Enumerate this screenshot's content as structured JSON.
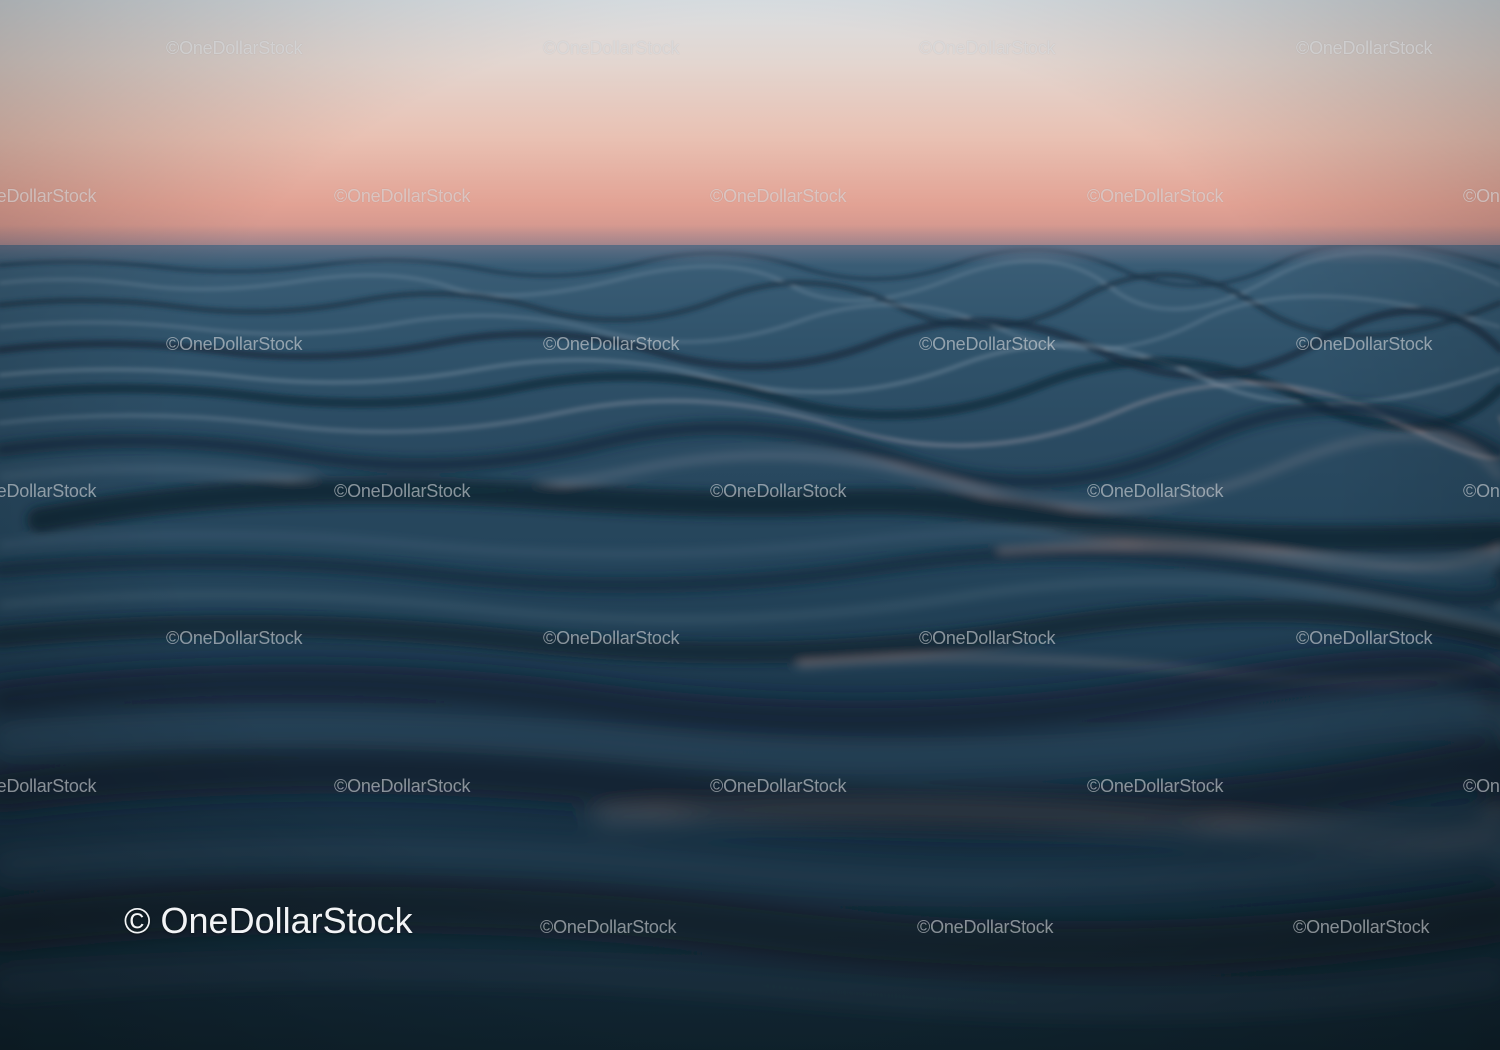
{
  "image": {
    "watermark_small": "©OneDollarStock",
    "watermark_large": "© OneDollarStock"
  },
  "colors": {
    "sky_top": "#d9dfe3",
    "sky_horizon": "#e2a294",
    "sea_near": "#10242f",
    "sea_far": "#3c5f78"
  }
}
